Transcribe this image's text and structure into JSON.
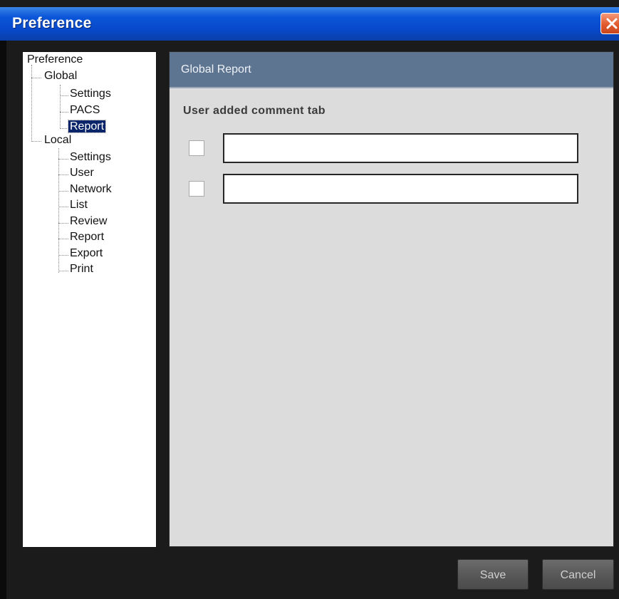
{
  "window": {
    "title": "Preference"
  },
  "tree": {
    "root": "Preference",
    "global": {
      "label": "Global",
      "items": [
        "Settings",
        "PACS",
        "Report"
      ],
      "selected": "Report"
    },
    "local": {
      "label": "Local",
      "items": [
        "Settings",
        "User",
        "Network",
        "List",
        "Review",
        "Report",
        "Export",
        "Print"
      ]
    }
  },
  "panel": {
    "title": "Global Report",
    "section_title": "User added comment tab",
    "rows": [
      {
        "checked": false,
        "value": ""
      },
      {
        "checked": false,
        "value": ""
      }
    ]
  },
  "buttons": {
    "save": "Save",
    "cancel": "Cancel"
  }
}
